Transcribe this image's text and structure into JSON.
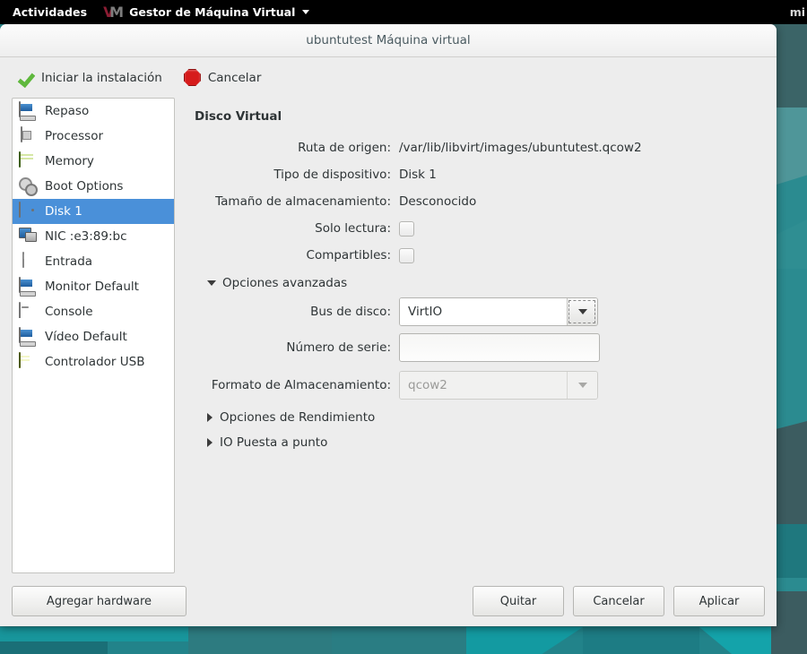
{
  "panel": {
    "activities": "Actividades",
    "app_menu": "Gestor de Máquina Virtual",
    "app_icon": "vm-logo-icon",
    "caret_icon": "chevron-down-icon",
    "right_status": "mi"
  },
  "window": {
    "title": "ubuntutest Máquina virtual"
  },
  "toolbar": {
    "start_install_label": "Iniciar la instalación",
    "start_install_icon": "green-check-icon",
    "cancel_label": "Cancelar",
    "cancel_icon": "red-stop-icon"
  },
  "sidebar": {
    "items": [
      {
        "label": "Repaso",
        "icon": "monitor-icon",
        "selected": false
      },
      {
        "label": "Processor",
        "icon": "cpu-icon",
        "selected": false
      },
      {
        "label": "Memory",
        "icon": "memory-icon",
        "selected": false
      },
      {
        "label": "Boot Options",
        "icon": "gears-icon",
        "selected": false
      },
      {
        "label": "Disk 1",
        "icon": "disk-icon",
        "selected": true
      },
      {
        "label": "NIC :e3:89:bc",
        "icon": "network-icon",
        "selected": false
      },
      {
        "label": "Entrada",
        "icon": "mouse-icon",
        "selected": false
      },
      {
        "label": "Monitor Default",
        "icon": "display-icon",
        "selected": false
      },
      {
        "label": "Console",
        "icon": "console-icon",
        "selected": false
      },
      {
        "label": "Vídeo Default",
        "icon": "display-icon",
        "selected": false
      },
      {
        "label": "Controlador USB",
        "icon": "usb-icon",
        "selected": false
      }
    ],
    "add_hardware_label": "Agregar hardware"
  },
  "details": {
    "section_title": "Disco Virtual",
    "fields": [
      {
        "label": "Ruta de origen:",
        "value": "/var/lib/libvirt/images/ubuntutest.qcow2"
      },
      {
        "label": "Tipo de dispositivo:",
        "value": "Disk 1"
      },
      {
        "label": "Tamaño de almacenamiento:",
        "value": "Desconocido"
      }
    ],
    "checkboxes": [
      {
        "label": "Solo lectura:",
        "checked": false
      },
      {
        "label": "Compartibles:",
        "checked": false
      }
    ],
    "advanced": {
      "expander_label": "Opciones avanzadas",
      "expanded": true,
      "disk_bus_label": "Bus de disco:",
      "disk_bus_value": "VirtIO",
      "serial_label": "Número de serie:",
      "serial_value": "",
      "storage_format_label": "Formato de Almacenamiento:",
      "storage_format_value": "qcow2",
      "storage_format_disabled": true
    },
    "sub_expanders": [
      {
        "label": "Opciones de Rendimiento",
        "expanded": false
      },
      {
        "label": "IO Puesta a punto",
        "expanded": false
      }
    ]
  },
  "footer": {
    "remove_label": "Quitar",
    "cancel_label": "Cancelar",
    "apply_label": "Aplicar"
  },
  "colors": {
    "selection_blue": "#4a90d9",
    "window_bg": "#ededed",
    "desktop_teal": "#268a8f",
    "panel_black": "#000000"
  }
}
